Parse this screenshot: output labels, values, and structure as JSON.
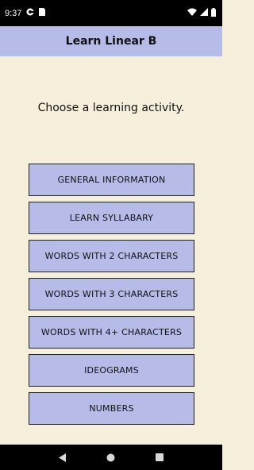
{
  "status_bar": {
    "time": "9:37",
    "icons": [
      "g-icon",
      "sim-card-icon",
      "wifi-icon",
      "cellular-signal-icon",
      "battery-icon"
    ]
  },
  "app_bar": {
    "title": "Learn Linear B"
  },
  "main": {
    "prompt": "Choose a learning activity.",
    "buttons": [
      {
        "label": "GENERAL INFORMATION"
      },
      {
        "label": "LEARN SYLLABARY"
      },
      {
        "label": "WORDS WITH 2 CHARACTERS"
      },
      {
        "label": "WORDS WITH 3 CHARACTERS"
      },
      {
        "label": "WORDS WITH 4+ CHARACTERS"
      },
      {
        "label": "IDEOGRAMS"
      },
      {
        "label": "NUMBERS"
      }
    ]
  },
  "nav_bar": {
    "icons": [
      "back-icon",
      "home-icon",
      "recents-icon"
    ]
  },
  "colors": {
    "background": "#f6efdb",
    "accent": "#b6bbe8",
    "status_bar": "#000000"
  }
}
